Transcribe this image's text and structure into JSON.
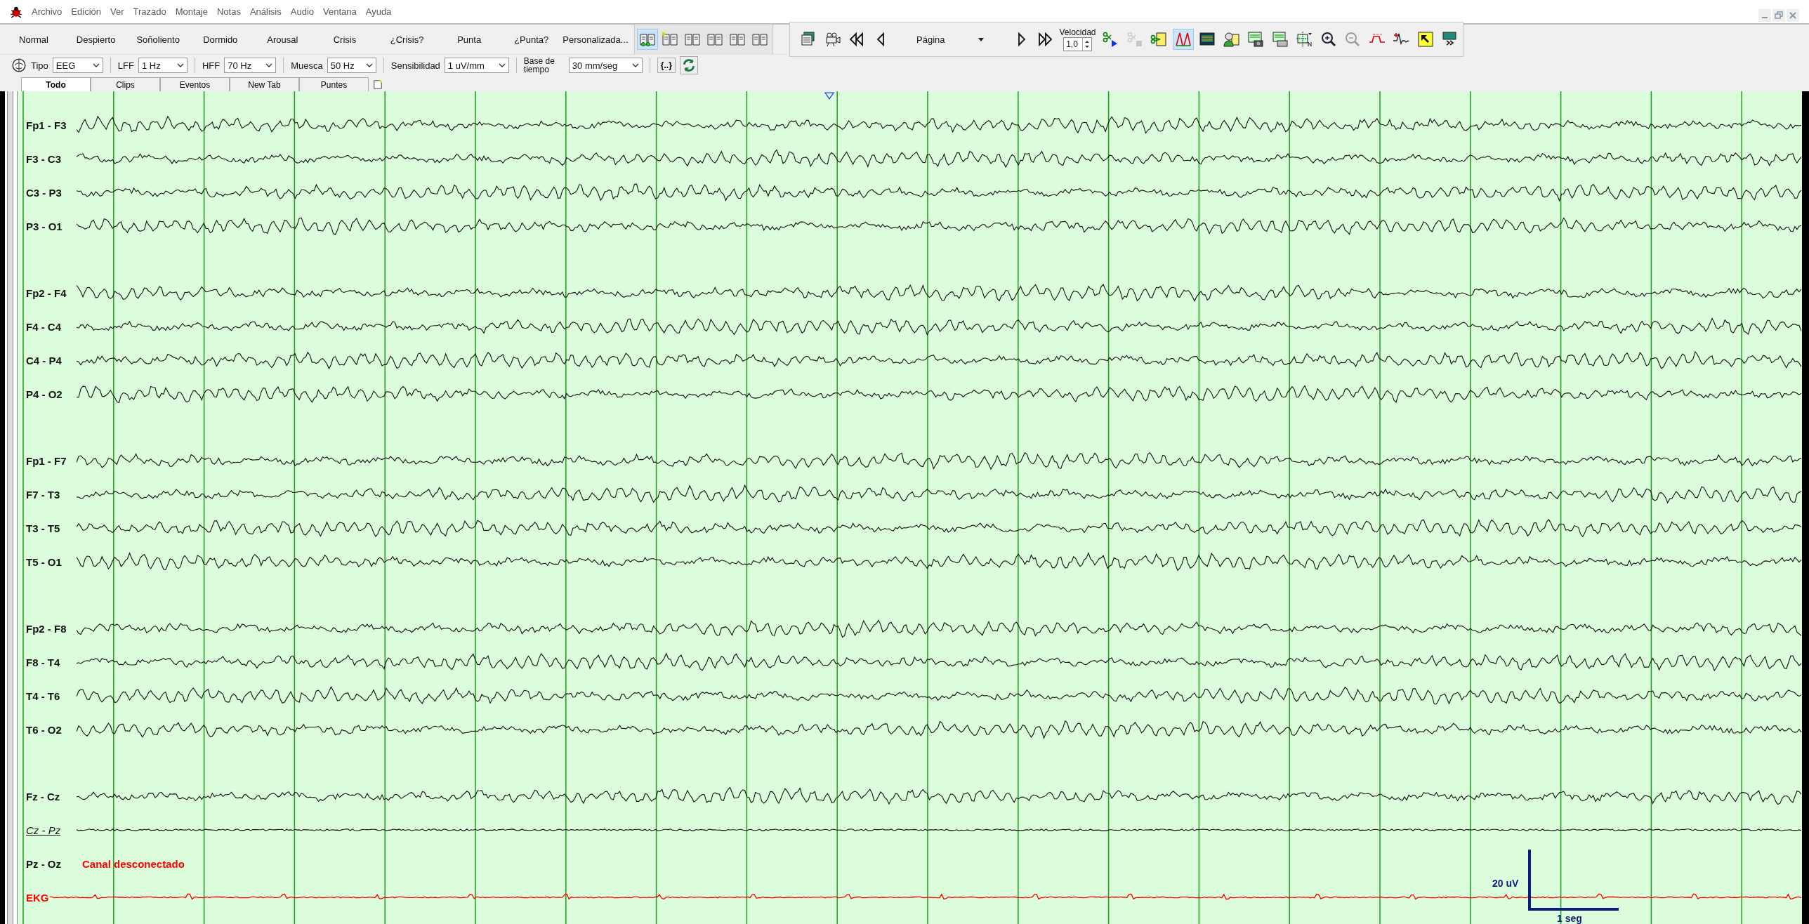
{
  "menu": [
    "Archivo",
    "Edición",
    "Ver",
    "Trazado",
    "Montaje",
    "Notas",
    "Análisis",
    "Audio",
    "Ventana",
    "Ayuda"
  ],
  "labels": [
    "Normal",
    "Despierto",
    "Soñoliento",
    "Dormido",
    "Arousal",
    "Crisis",
    "¿Crisis?",
    "Punta",
    "¿Punta?",
    "Personalizada..."
  ],
  "book_views": [
    {
      "selected": true
    },
    {
      "selected": false
    },
    {
      "selected": false
    },
    {
      "selected": false
    },
    {
      "selected": false
    },
    {
      "selected": false
    }
  ],
  "playback": {
    "page_mode": "Página",
    "speed_label": "Velocidad",
    "speed": "1,0",
    "cut_disabled": true,
    "peaks_view_selected": true,
    "zoom_out_disabled": true
  },
  "filters": [
    {
      "label": "Tipo",
      "value": "EEG"
    },
    {
      "label": "LFF",
      "value": "1 Hz"
    },
    {
      "label": "HFF",
      "value": "70 Hz"
    },
    {
      "label": "Muesca",
      "value": "50 Hz"
    },
    {
      "label": "Sensibilidad",
      "value": "1 uV/mm"
    },
    {
      "label": "Base de tiempo",
      "value": "30 mm/seg"
    }
  ],
  "marks_button": "{..}",
  "tabs": [
    {
      "label": "Todo",
      "selected": true
    },
    {
      "label": "Clips",
      "selected": false
    },
    {
      "label": "Eventos",
      "selected": false
    },
    {
      "label": "New Tab",
      "selected": false
    },
    {
      "label": "Puntes",
      "selected": false
    }
  ],
  "montage_groups": [
    {
      "channels": [
        {
          "name": "Fp1 - F3",
          "kind": "eeg"
        },
        {
          "name": "F3 - C3",
          "kind": "eeg"
        },
        {
          "name": "C3 - P3",
          "kind": "eeg"
        },
        {
          "name": "P3 - O1",
          "kind": "eeg"
        }
      ]
    },
    {
      "channels": [
        {
          "name": "Fp2 - F4",
          "kind": "eeg"
        },
        {
          "name": "F4 - C4",
          "kind": "eeg"
        },
        {
          "name": "C4 - P4",
          "kind": "eeg"
        },
        {
          "name": "P4 - O2",
          "kind": "eeg"
        }
      ]
    },
    {
      "channels": [
        {
          "name": "Fp1 - F7",
          "kind": "eeg"
        },
        {
          "name": "F7 - T3",
          "kind": "eeg"
        },
        {
          "name": "T3 - T5",
          "kind": "eeg"
        },
        {
          "name": "T5 - O1",
          "kind": "eeg"
        }
      ]
    },
    {
      "channels": [
        {
          "name": "Fp2 - F8",
          "kind": "eeg"
        },
        {
          "name": "F8 - T4",
          "kind": "eeg"
        },
        {
          "name": "T4 - T6",
          "kind": "eeg"
        },
        {
          "name": "T6 - O2",
          "kind": "eeg"
        }
      ]
    },
    {
      "channels": [
        {
          "name": "Fz - Cz",
          "kind": "eeg"
        },
        {
          "name": "Cz - Pz",
          "kind": "flat"
        },
        {
          "name": "Pz - Oz",
          "kind": "disconnected",
          "status": "Canal desconectado"
        },
        {
          "name": "EKG",
          "kind": "ekg"
        }
      ]
    }
  ],
  "scale": {
    "amplitude": "20 uV",
    "time": "1 seg"
  }
}
